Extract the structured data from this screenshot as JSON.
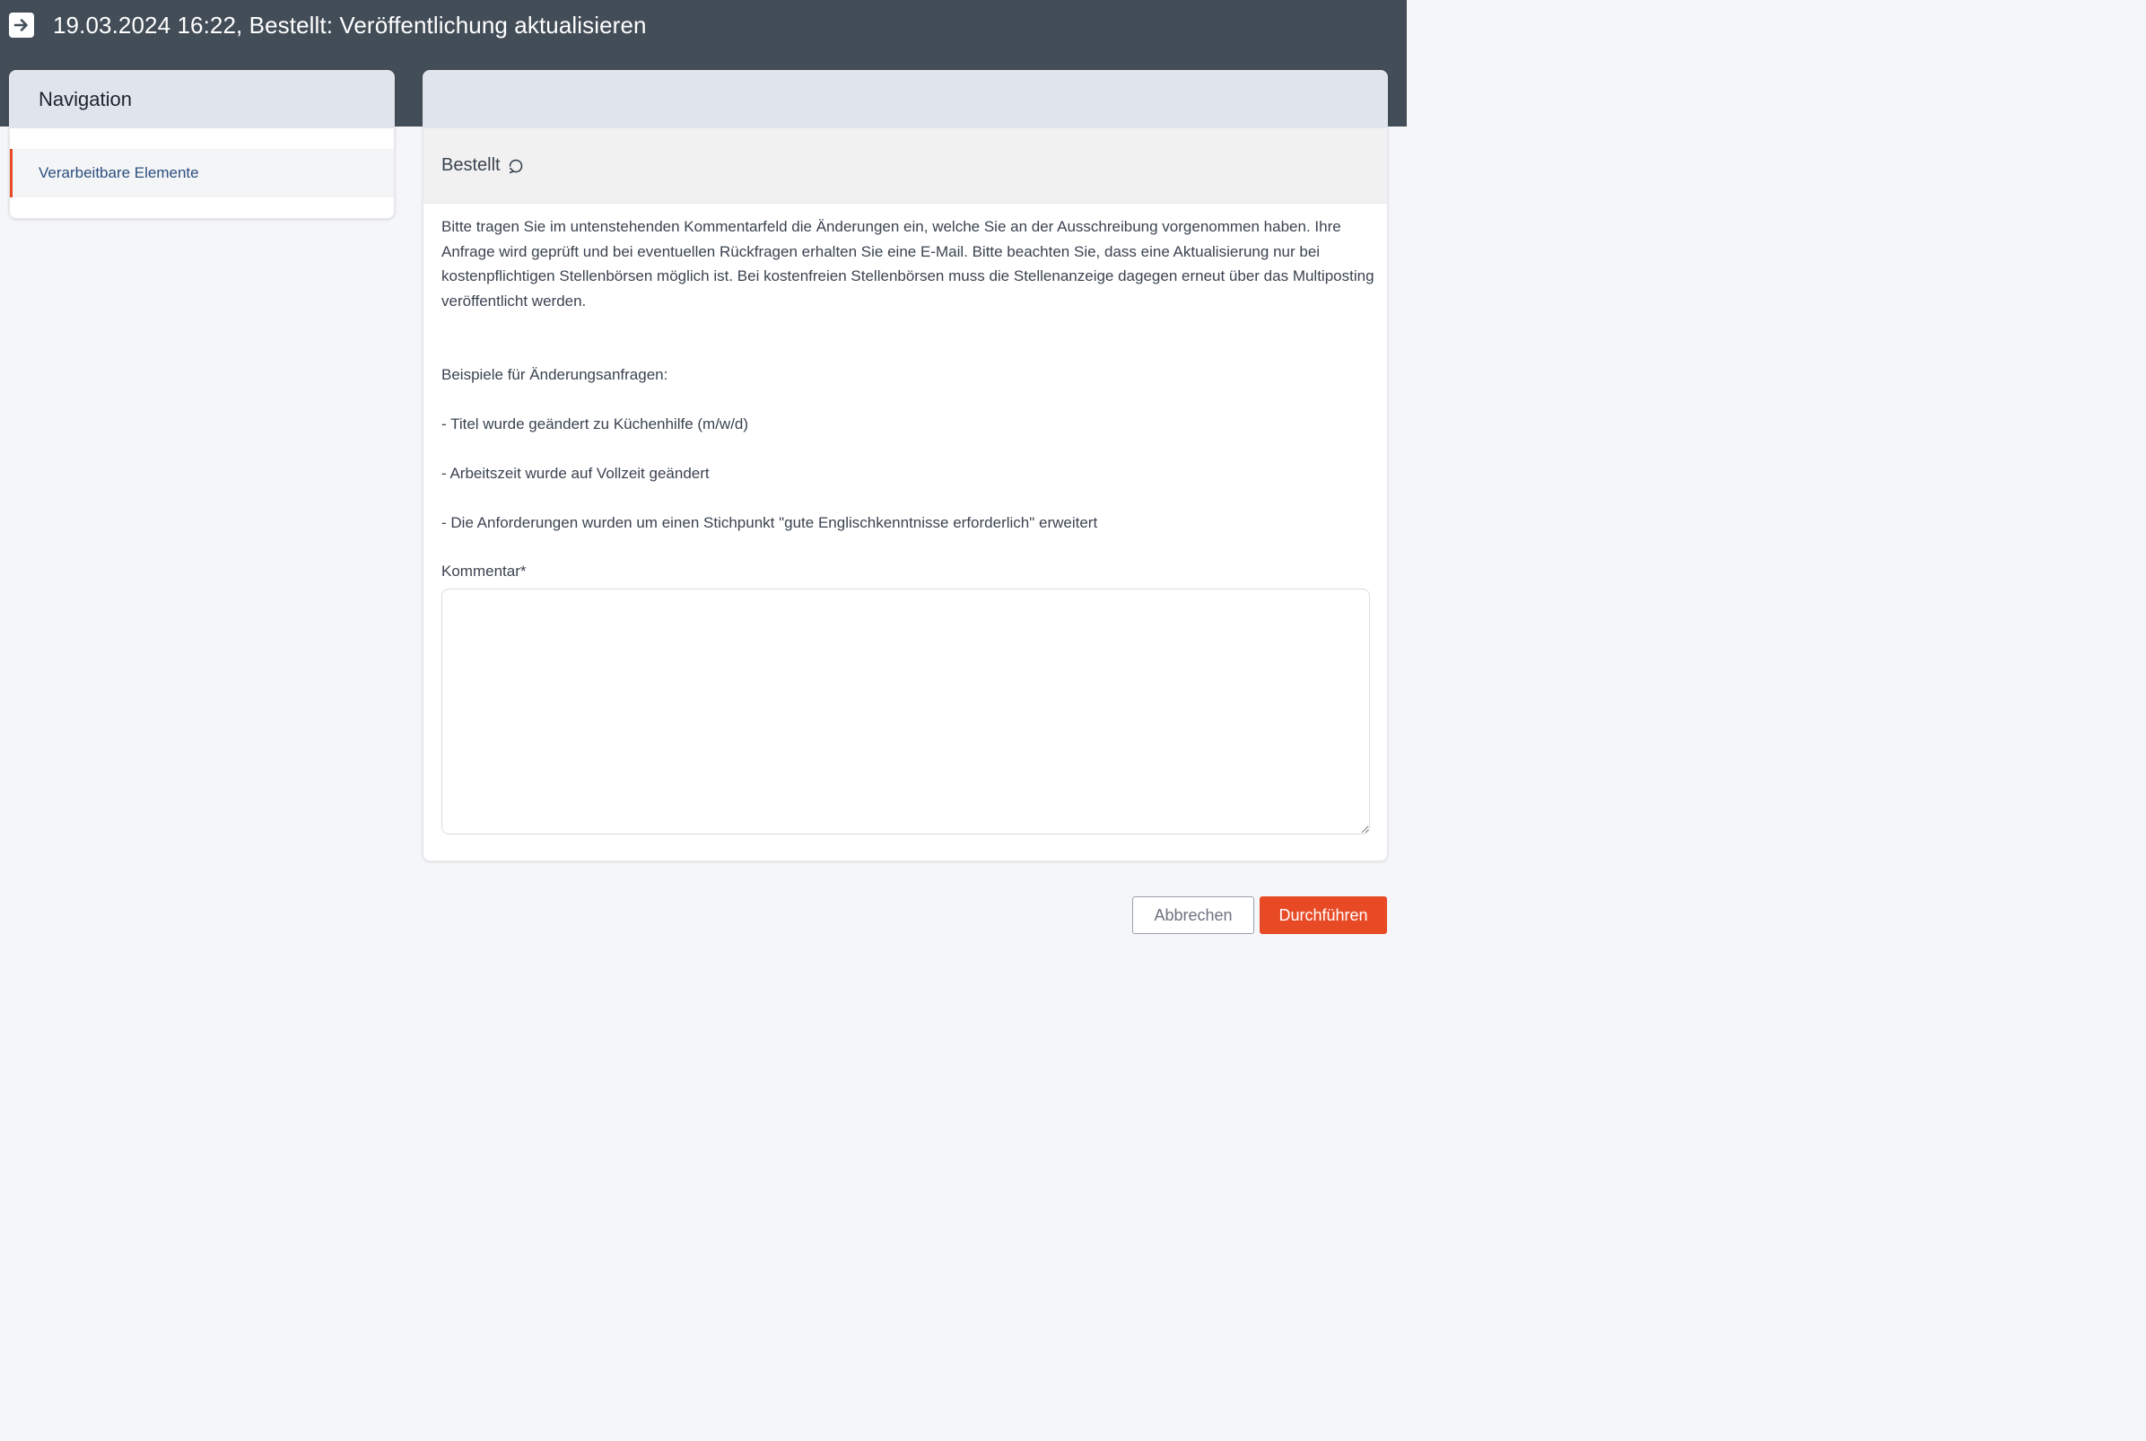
{
  "header": {
    "title": "19.03.2024 16:22, Bestellt: Veröffentlichung aktualisieren",
    "icon": "arrow-right-square-icon"
  },
  "navigation": {
    "title": "Navigation",
    "items": [
      {
        "label": "Verarbeitbare Elemente",
        "active": true
      }
    ]
  },
  "main": {
    "status_label": "Bestellt",
    "status_icon": "refresh-icon",
    "intro_text": "Bitte tragen Sie im untenstehenden Kommentarfeld die Änderungen ein, welche Sie an der Ausschreibung vorgenommen haben. Ihre Anfrage wird geprüft und bei eventuellen Rückfragen erhalten Sie eine E-Mail. Bitte beachten Sie, dass eine Aktualisierung nur bei kostenpflichtigen Stellenbörsen möglich ist. Bei kostenfreien Stellenbörsen muss die Stellenanzeige dagegen erneut über das Multiposting veröffentlicht werden.",
    "examples_heading": "Beispiele für Änderungsanfragen:",
    "examples": [
      "- Titel wurde geändert zu Küchenhilfe (m/w/d)",
      "- Arbeitszeit wurde auf Vollzeit geändert",
      "- Die Anforderungen wurden um einen Stichpunkt \"gute Englischkenntnisse erforderlich\" erweitert"
    ],
    "comment_label": "Kommentar*",
    "comment_value": ""
  },
  "footer": {
    "cancel_label": "Abbrechen",
    "submit_label": "Durchführen"
  },
  "colors": {
    "header_bg": "#434d58",
    "accent": "#e84a26",
    "nav_link": "#2c4f7f",
    "card_head_bg": "#e0e4ec"
  }
}
